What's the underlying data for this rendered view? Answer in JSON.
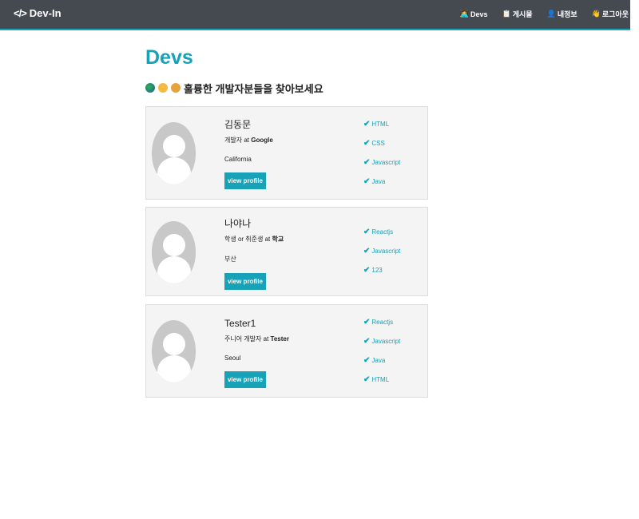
{
  "navbar": {
    "brand": "Dev-In",
    "links": [
      {
        "label": "Devs"
      },
      {
        "label": "게시물"
      },
      {
        "label": "내정보"
      },
      {
        "label": "로그아웃"
      }
    ]
  },
  "main": {
    "title": "Devs",
    "lead": "훌륭한 개발자분들을 찾아보세요"
  },
  "profiles": [
    {
      "name": "김동문",
      "role": "개발자",
      "company": "Google",
      "location": "California",
      "button": "view profile",
      "skills": [
        "HTML",
        "CSS",
        "Javascript",
        "Java"
      ]
    },
    {
      "name": "나야나",
      "role": "학생 or 취준생",
      "company": "학교",
      "location": "부산",
      "button": "view profile",
      "skills": [
        "Reactjs",
        "Javascript",
        "123"
      ]
    },
    {
      "name": "Tester1",
      "role": "주니어 개발자",
      "company": "Tester",
      "location": "Seoul",
      "button": "view profile",
      "skills": [
        "Reactjs",
        "Javascript",
        "Java",
        "HTML"
      ]
    }
  ],
  "connector": "at",
  "colors": {
    "accent": "#17a2b8",
    "navbar": "#454a51",
    "card": "#f4f4f4"
  }
}
